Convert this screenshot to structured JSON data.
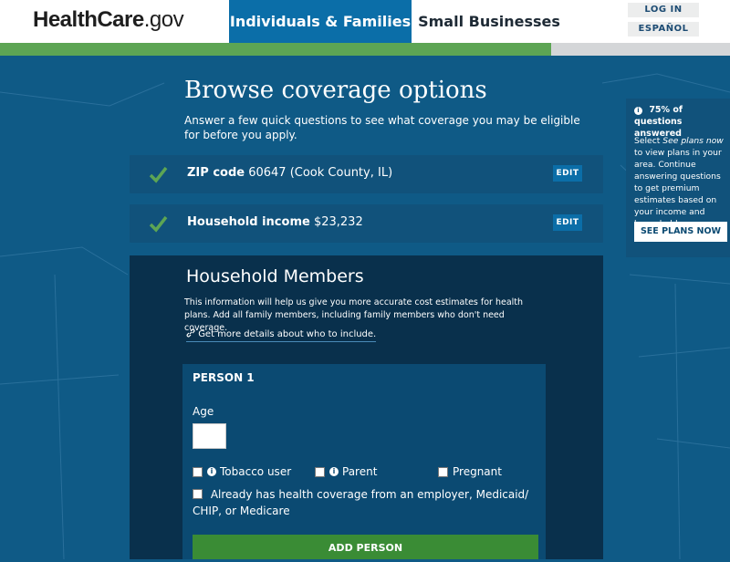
{
  "header": {
    "logo_main": "HealthCare",
    "logo_suffix": ".gov",
    "tabs": [
      {
        "label": "Individuals & Families"
      },
      {
        "label": "Small Businesses"
      }
    ],
    "login_label": "LOG IN",
    "espanol_label": "ESPAÑOL"
  },
  "progress": {
    "fraction": 0.755
  },
  "main": {
    "title": "Browse coverage options",
    "intro": "Answer a few quick questions to see what coverage you may be eligible for before you apply.",
    "steps": [
      {
        "label": "ZIP code",
        "value": "60647 (Cook County, IL)",
        "edit": "EDIT"
      },
      {
        "label": "Household income",
        "value": "$23,232",
        "edit": "EDIT"
      }
    ]
  },
  "members": {
    "title": "Household Members",
    "intro": "This information will help us give you more accurate cost estimates for health plans. Add all family members, including family members who don't need coverage.",
    "link": "Get more details about who to include.",
    "person": {
      "heading": "PERSON 1",
      "age_label": "Age",
      "age_value": "",
      "tobacco": "Tobacco user",
      "parent": "Parent",
      "pregnant": "Pregnant",
      "coverage": "Already has health coverage from an employer, Medicaid/ CHIP, or Medicare"
    },
    "add_button": "ADD PERSON"
  },
  "sidebar": {
    "percent_title": "75% of questions answered",
    "text_pre": "Select ",
    "text_em": "See plans now",
    "text_post": " to view plans in your area. Continue answering questions to get premium estimates based on your income and household.",
    "button": "SEE PLANS NOW"
  },
  "colors": {
    "brand_blue": "#0b6ea8",
    "background": "#0f5a86",
    "panel": "#09304c",
    "success_green": "#5da554",
    "button_green": "#3a8c35"
  }
}
